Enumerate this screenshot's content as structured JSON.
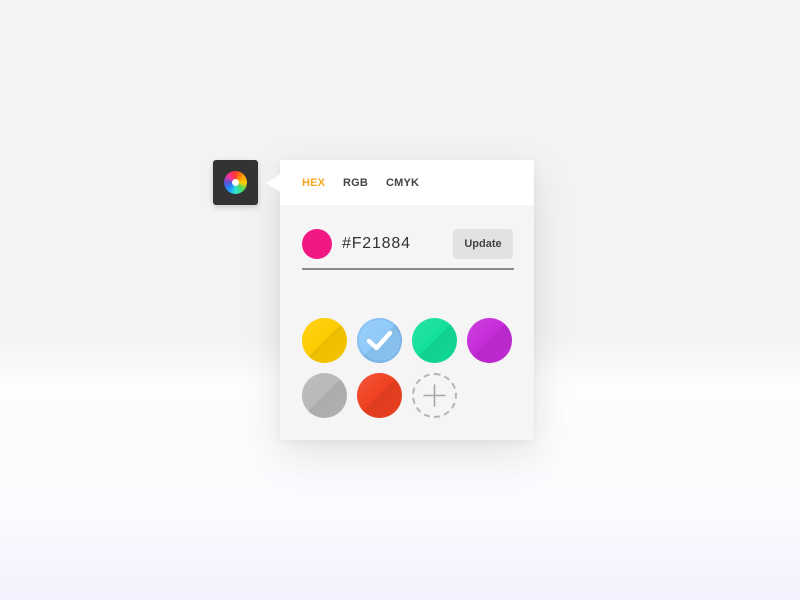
{
  "trigger": {
    "icon": "color-wheel-icon"
  },
  "tabs": [
    {
      "label": "HEX",
      "active": true
    },
    {
      "label": "RGB",
      "active": false
    },
    {
      "label": "CMYK",
      "active": false
    }
  ],
  "input": {
    "current_color": "#F21884",
    "value": "#F21884",
    "update_label": "Update"
  },
  "swatches": [
    {
      "color": "#FFCC00",
      "selected": false
    },
    {
      "color": "#90CAF9",
      "selected": true,
      "icon": "checkmark-icon"
    },
    {
      "color": "#12E09A",
      "selected": false
    },
    {
      "color": "#C52BD8",
      "selected": false
    },
    {
      "color": "#B7B8BA",
      "selected": false
    },
    {
      "color": "#F04121",
      "selected": false
    }
  ],
  "add_swatch": {
    "icon": "plus-icon"
  },
  "colors": {
    "accent": "#F5A623",
    "trigger_bg": "#333333",
    "panel_bg": "#F5F5F5"
  }
}
